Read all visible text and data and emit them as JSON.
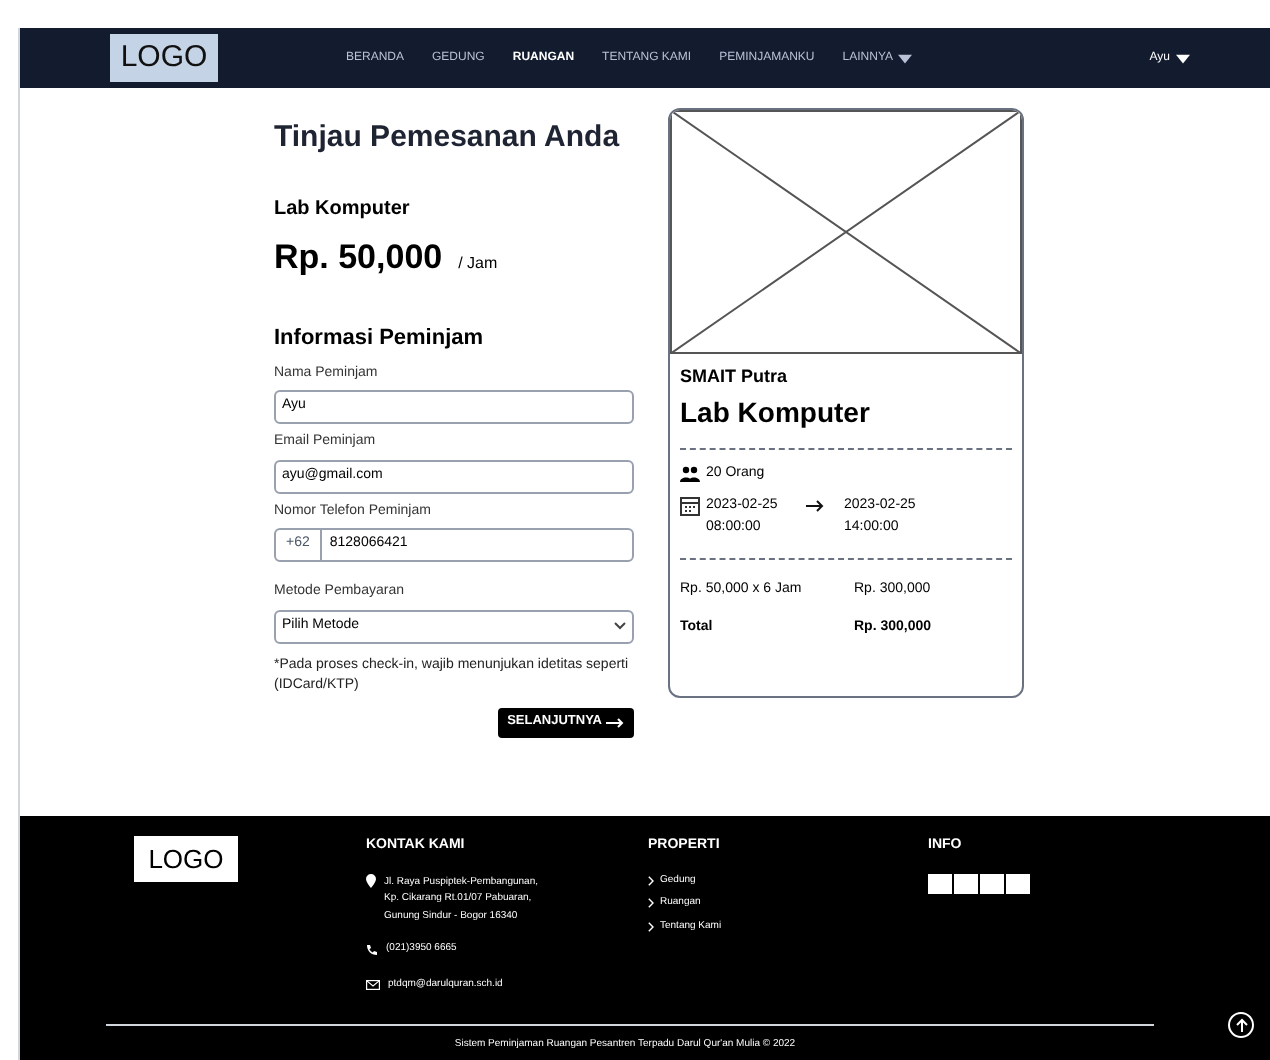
{
  "navbar": {
    "logo": "LOGO",
    "items": [
      {
        "label": "BERANDA",
        "selected": false
      },
      {
        "label": "GEDUNG",
        "selected": false
      },
      {
        "label": "RUANGAN",
        "selected": true
      },
      {
        "label": "TENTANG KAMI",
        "selected": false
      },
      {
        "label": "PEMINJAMANKU",
        "selected": false
      },
      {
        "label": "LAINNYA",
        "selected": false,
        "dropdown": true
      }
    ],
    "user": "Ayu"
  },
  "review": {
    "title": "Tinjau Pemesanan Anda",
    "room": "Lab Komputer",
    "price": "Rp. 50,000",
    "unit": "/ Jam",
    "section": "Informasi Peminjam",
    "fields": [
      {
        "kind": "text",
        "label": "Nama Peminjam",
        "value": "Ayu"
      },
      {
        "kind": "text",
        "label": "Email Peminjam",
        "value": "ayu@gmail.com"
      },
      {
        "kind": "phone",
        "label": "Nomor Telefon Peminjam",
        "prefix": "+62",
        "value": "8128066421"
      },
      {
        "kind": "select",
        "label": "Metode Pembayaran",
        "value": "Pilih Metode"
      }
    ],
    "note": "*Pada proses check-in, wajib menunjukan idetitas seperti (IDCard/KTP)",
    "next_button": "SELANJUTNYA"
  },
  "summary": {
    "building": "SMAIT Putra",
    "room": "Lab Komputer",
    "capacity": "20 Orang",
    "start_date": "2023-02-25",
    "start_time": "08:00:00",
    "end_date": "2023-02-25",
    "end_time": "14:00:00",
    "calc_label": "Rp. 50,000 x 6 Jam",
    "calc_value": "Rp. 300,000",
    "total_label": "Total",
    "total_value": "Rp. 300,000"
  },
  "footer": {
    "logo": "LOGO",
    "contact": {
      "title": "KONTAK KAMI",
      "address": "Jl. Raya Puspiptek-Pembangunan, Kp. Cikarang Rt.01/07 Pabuaran, Gunung Sindur - Bogor 16340",
      "phone": "(021)3950 6665",
      "email": "ptdqm@darulquran.sch.id"
    },
    "property": {
      "title": "PROPERTI",
      "links": [
        "Gedung",
        "Ruangan",
        "Tentang Kami"
      ]
    },
    "info": {
      "title": "INFO"
    },
    "copyright": "Sistem Peminjaman Ruangan Pesantren Terpadu Darul Qur'an Mulia © 2022"
  }
}
